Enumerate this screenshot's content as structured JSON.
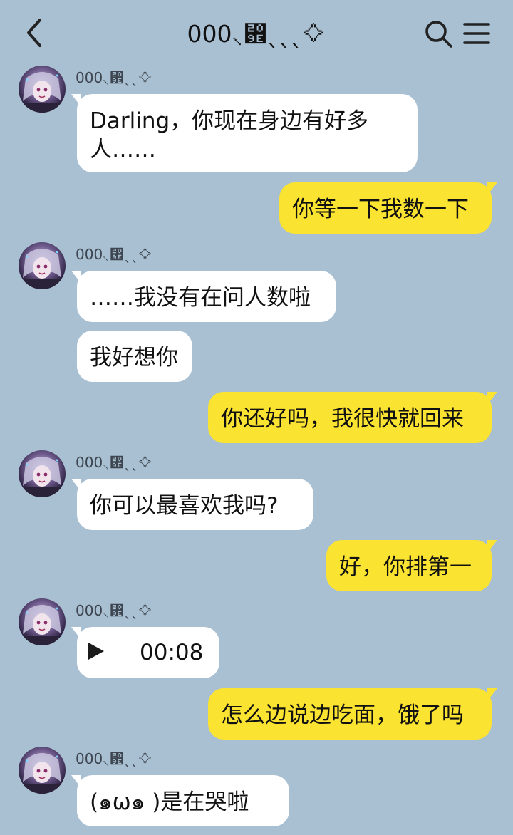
{
  "header": {
    "title": "000⸜₞ˎˎˎ⟡",
    "back_icon": "chevron-left-icon",
    "search_icon": "search-icon",
    "menu_icon": "hamburger-menu-icon"
  },
  "colors": {
    "background": "#a9bfd2",
    "incoming_bubble": "#ffffff",
    "outgoing_bubble": "#fbe331"
  },
  "messages": [
    {
      "side": "left",
      "sender": "000⸜₞ˎˎ⟡",
      "text": "Darling，你现在身边有好多\n人……"
    },
    {
      "side": "right",
      "text": "你等一下我数一下"
    },
    {
      "side": "left",
      "sender": "000⸜₞ˎˎ⟡",
      "text": "……我没有在问人数啦"
    },
    {
      "side": "left",
      "text": "我好想你"
    },
    {
      "side": "right",
      "text": "你还好吗，我很快就回来"
    },
    {
      "side": "left",
      "sender": "000⸜₞ˎˎ⟡",
      "text": "你可以最喜欢我吗?"
    },
    {
      "side": "right",
      "text": "好，你排第一"
    },
    {
      "side": "left",
      "sender": "000⸜₞ˎˎ⟡",
      "type": "voice",
      "duration": "00:08",
      "play_icon": "play-icon"
    },
    {
      "side": "right",
      "text": "怎么边说边吃面，饿了吗"
    },
    {
      "side": "left",
      "sender": "000⸜₞ˎˎ⟡",
      "text": "(๑ω๑ )是在哭啦"
    }
  ]
}
